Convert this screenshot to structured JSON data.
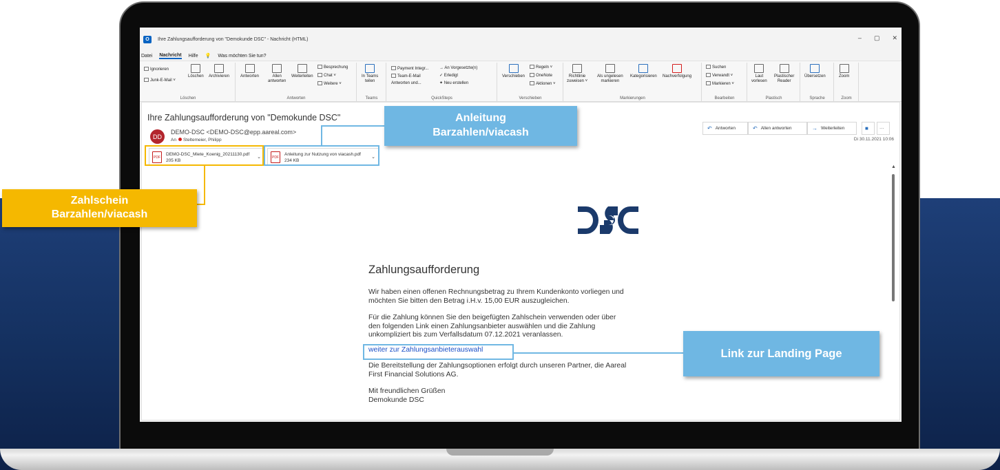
{
  "window": {
    "title": "Ihre Zahlungsaufforderung von \"Demokunde DSC\"  -  Nachricht (HTML)",
    "app_icon": "outlook-icon",
    "controls": [
      "–",
      "▢",
      "✕"
    ]
  },
  "menu": {
    "items": [
      "Datei",
      "Nachricht",
      "Hilfe"
    ],
    "active": "Nachricht",
    "search": "Was möchten Sie tun?"
  },
  "ribbon": {
    "loeschen": {
      "label": "Löschen",
      "ignore": "Ignorieren",
      "junk": "Junk-E-Mail ˅",
      "delete": "Löschen",
      "archive": "Archivieren"
    },
    "antworten": {
      "label": "Antworten",
      "reply": "Antworten",
      "reply_all_1": "Allen",
      "reply_all_2": "antworten",
      "forward": "Weiterleiten",
      "meeting": "Besprechung",
      "chat": "Chat ˅",
      "more": "Weitere ˅"
    },
    "teams": {
      "label": "Teams",
      "line1": "In Teams",
      "line2": "teilen"
    },
    "quicksteps": {
      "label": "QuickSteps",
      "items": [
        "Payment Integr...",
        "Team-E-Mail",
        "Antworten und...",
        "→ An Vorgesetzte(n)",
        "✓ Erledigt",
        "✦ Neu erstellen"
      ]
    },
    "verschieben": {
      "label": "Verschieben",
      "move": "Verschieben",
      "rules": "Regeln ˅",
      "onenote": "OneNote",
      "actions": "Aktionen ˅"
    },
    "markierungen": {
      "label": "Markierungen",
      "policy_1": "Richtlinie",
      "policy_2": "zuweisen ˅",
      "unread_1": "Als ungelesen",
      "unread_2": "markieren",
      "categorize": "Kategorisieren",
      "followup": "Nachverfolgung"
    },
    "bearbeiten": {
      "label": "Bearbeiten",
      "search": "Suchen",
      "related": "Verwandt ˅",
      "select": "Markieren ˅"
    },
    "plastisch": {
      "label": "Plastisch",
      "read_1": "Laut",
      "read_2": "vorlesen",
      "reader_1": "Plastischer",
      "reader_2": "Reader"
    },
    "sprache": {
      "label": "Sprache",
      "translate": "Übersetzen"
    },
    "zoom": {
      "label": "Zoom",
      "zoom": "Zoom"
    }
  },
  "message": {
    "subject": "Ihre Zahlungsaufforderung von \"Demokunde DSC\"",
    "avatar": "DD",
    "sender": "DEMO-DSC <DEMO-DSC@epp.aareal.com>",
    "to_label": "An",
    "to": "Steltemeier, Philipp",
    "attachments": [
      {
        "name": "DEMO-DSC_Miete_Koenig_20211130.pdf",
        "size": "205 KB"
      },
      {
        "name": "Anleitung zur Nutzung von viacash.pdf",
        "size": "234 KB"
      }
    ],
    "actions": {
      "reply": "Antworten",
      "reply_all": "Allen antworten",
      "forward": "Weiterleiten",
      "more": "···"
    },
    "date": "Di 30.11.2021 10:06"
  },
  "email": {
    "logo": "DSC",
    "title": "Zahlungsaufforderung",
    "p1": [
      "Wir haben einen offenen Rechnungsbetrag zu Ihrem Kundenkonto vorliegen und",
      "möchten Sie bitten den Betrag i.H.v. 15,00 EUR auszugleichen."
    ],
    "p2": [
      "Für die Zahlung können Sie den beigefügten Zahlschein verwenden oder über",
      "den folgenden Link einen Zahlungsanbieter auswählen und die Zahlung",
      "unkompliziert bis zum Verfallsdatum 07.12.2021 veranlassen."
    ],
    "link": "weiter zur Zahlungsanbieterauswahl",
    "p3": [
      "Die Bereitstellung der Zahlungsoptionen erfolgt durch unseren Partner, die Aareal",
      "First Financial Solutions AG."
    ],
    "p4": [
      "Mit freundlichen Grüßen",
      "Demokunde DSC"
    ]
  },
  "callouts": {
    "anleitung": [
      "Anleitung",
      "Barzahlen/viacash"
    ],
    "zahlschein": [
      "Zahlschein",
      "Barzahlen/viacash"
    ],
    "landing": "Link zur Landing Page"
  },
  "colors": {
    "blue_callout": "#6fb7e3",
    "yellow_callout": "#f5b800",
    "background": "#14305f",
    "link": "#1a4fc7",
    "avatar": "#b3262d"
  }
}
